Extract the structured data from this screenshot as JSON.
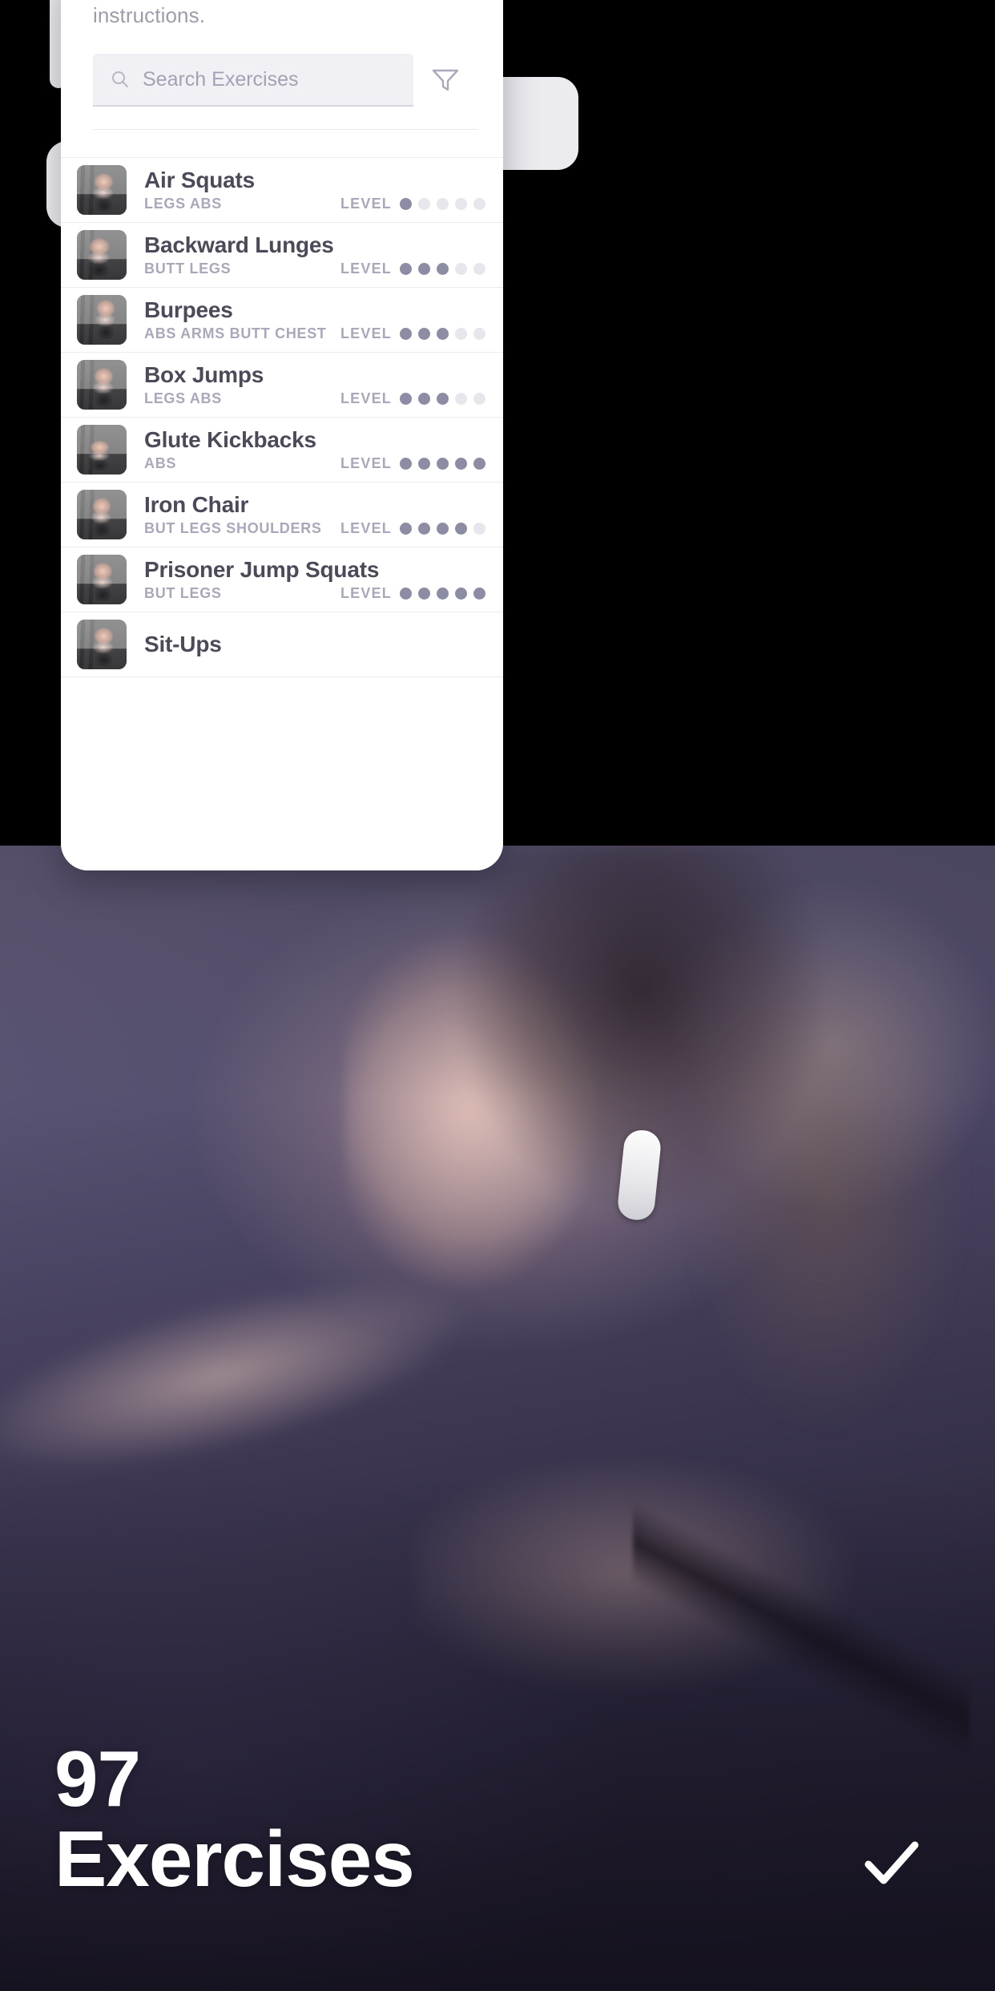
{
  "screen": {
    "intro_text": "instructions.",
    "search": {
      "placeholder": "Search Exercises",
      "icon": "search-icon",
      "filter_icon": "filter-icon"
    },
    "level_label": "LEVEL",
    "level_max": 5,
    "exercises": [
      {
        "name": "Air Squats",
        "tags": "LEGS ABS",
        "level": 1
      },
      {
        "name": "Backward Lunges",
        "tags": "BUTT LEGS",
        "level": 3
      },
      {
        "name": "Burpees",
        "tags": "ABS ARMS BUTT CHEST",
        "level": 3
      },
      {
        "name": "Box Jumps",
        "tags": "LEGS ABS",
        "level": 3
      },
      {
        "name": "Glute Kickbacks",
        "tags": "ABS",
        "level": 5
      },
      {
        "name": "Iron Chair",
        "tags": "BUT LEGS SHOULDERS",
        "level": 4
      },
      {
        "name": "Prisoner Jump Squats",
        "tags": "BUT LEGS",
        "level": 5
      },
      {
        "name": "Sit-Ups",
        "tags": "",
        "level": 0
      }
    ]
  },
  "hero": {
    "count": "97",
    "word": "Exercises",
    "check_icon": "check-icon"
  },
  "colors": {
    "title": "#4a4a58",
    "tag": "#a8a8ba",
    "dot_on": "#8c8ca4",
    "dot_off": "#e6e6ec",
    "card_bg": "#ffffff",
    "search_bg": "#f1f1f5",
    "hero_overlay": "#3b3550"
  }
}
